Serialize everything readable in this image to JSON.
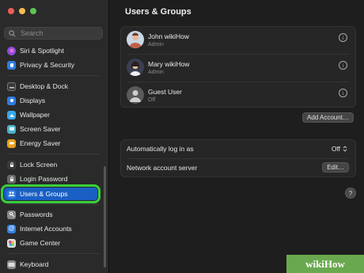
{
  "window": {
    "title": "Users & Groups"
  },
  "search": {
    "placeholder": "Search"
  },
  "sidebar": {
    "items": [
      {
        "label": "Siri & Spotlight",
        "icon": "siri-icon",
        "color": "#8a4fd8"
      },
      {
        "label": "Privacy & Security",
        "icon": "hand-icon",
        "color": "#2f7de0"
      },
      {
        "label": "Desktop & Dock",
        "icon": "dock-icon",
        "color": "#3a3a3a"
      },
      {
        "label": "Displays",
        "icon": "sun-icon",
        "color": "#2f7de0"
      },
      {
        "label": "Wallpaper",
        "icon": "wallpaper-icon",
        "color": "#38a8e8"
      },
      {
        "label": "Screen Saver",
        "icon": "screensaver-icon",
        "color": "#4ab0c8"
      },
      {
        "label": "Energy Saver",
        "icon": "battery-icon",
        "color": "#e8a020"
      },
      {
        "label": "Lock Screen",
        "icon": "lock-icon",
        "color": "#3a3a3a"
      },
      {
        "label": "Login Password",
        "icon": "login-lock-icon",
        "color": "#6a6a6a"
      },
      {
        "label": "Users & Groups",
        "icon": "users-icon",
        "color": "#2f7de0"
      },
      {
        "label": "Passwords",
        "icon": "key-icon",
        "color": "#8a8a8a"
      },
      {
        "label": "Internet Accounts",
        "icon": "at-icon",
        "color": "#2f7de0"
      },
      {
        "label": "Game Center",
        "icon": "game-center-icon",
        "color": "#e0e0e0"
      },
      {
        "label": "Keyboard",
        "icon": "keyboard-icon",
        "color": "#8a8a8a"
      }
    ],
    "selected": "Users & Groups"
  },
  "users": [
    {
      "name": "John wikiHow",
      "role": "Admin"
    },
    {
      "name": "Mary wikiHow",
      "role": "Admin"
    },
    {
      "name": "Guest User",
      "role": "Off"
    }
  ],
  "buttons": {
    "add_account": "Add Account…",
    "edit": "Edit…",
    "help": "?"
  },
  "settings": {
    "auto_login": {
      "label": "Automatically log in as",
      "value": "Off"
    },
    "network_server": {
      "label": "Network account server"
    }
  },
  "watermark": {
    "part1": "wiki",
    "part2": "How"
  },
  "colors": {
    "accent": "#1a5fc4",
    "highlight": "#3ad03a"
  }
}
